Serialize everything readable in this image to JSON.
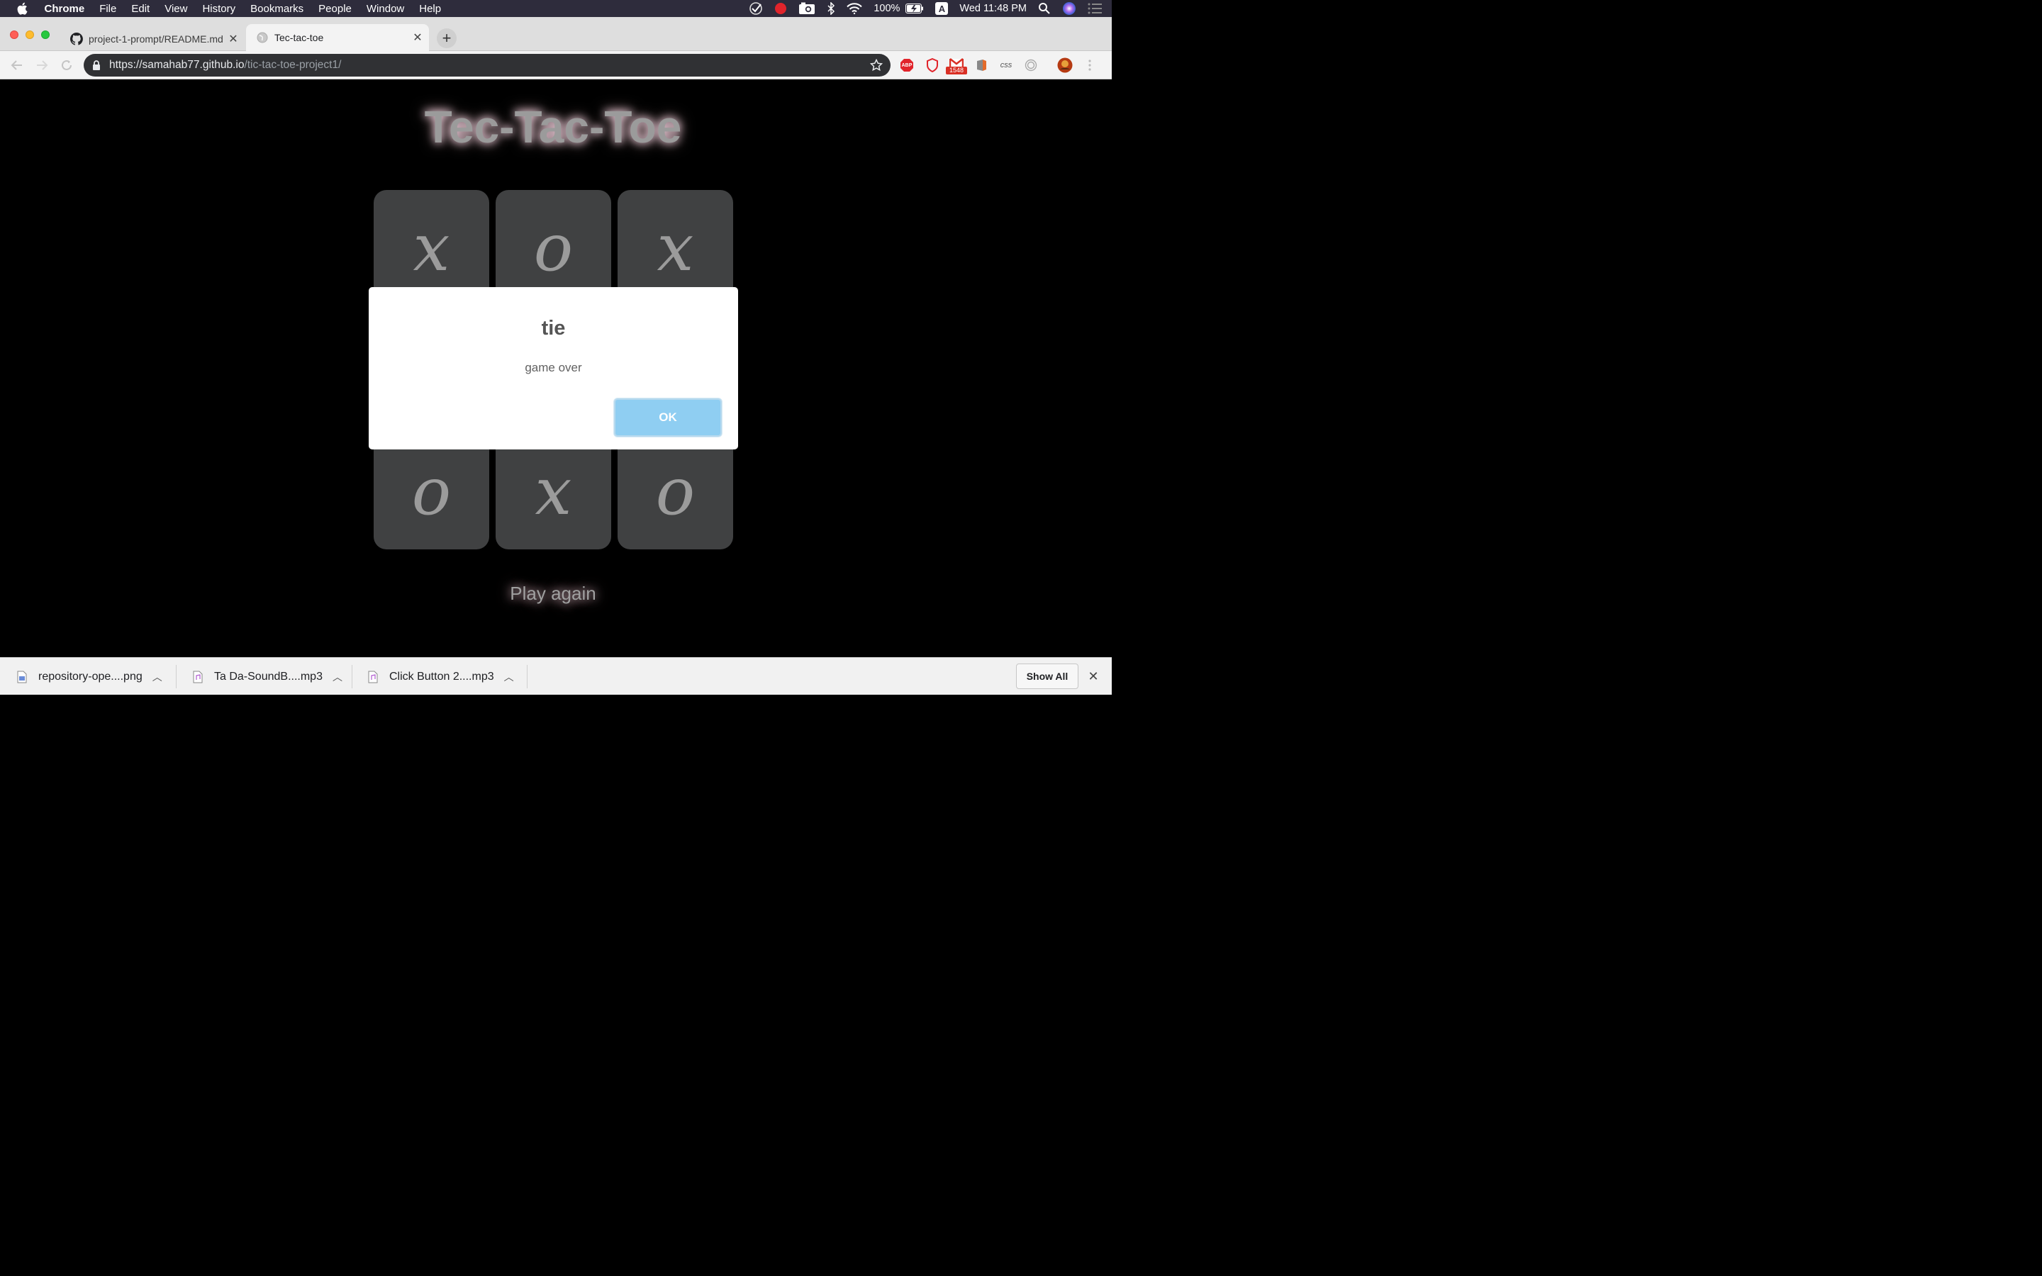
{
  "menubar": {
    "app_name": "Chrome",
    "items": [
      "File",
      "Edit",
      "View",
      "History",
      "Bookmarks",
      "People",
      "Window",
      "Help"
    ],
    "battery": "100%",
    "input_source": "A",
    "clock": "Wed 11:48 PM"
  },
  "tabs": [
    {
      "title": "project-1-prompt/README.md",
      "favicon": "github-icon"
    },
    {
      "title": "Tec-tac-toe",
      "favicon": "globe-icon"
    }
  ],
  "toolbar": {
    "url_host": "https://samahab77.github.io",
    "url_path": "/tic-tac-toe-project1/",
    "ext_mail_badge": "1548",
    "ext_css_label": "css",
    "ext_abp_label": "ABP"
  },
  "game": {
    "title": "Tec-Tac-Toe",
    "board": [
      "x",
      "o",
      "x",
      "",
      "",
      "",
      "o",
      "x",
      "o"
    ],
    "play_again": "Play again"
  },
  "dialog": {
    "title": "tie",
    "text": "game over",
    "ok_label": "OK"
  },
  "downloads": {
    "items": [
      {
        "name": "repository-ope....png"
      },
      {
        "name": "Ta Da-SoundB....mp3"
      },
      {
        "name": "Click Button 2....mp3"
      }
    ],
    "show_all_label": "Show All"
  },
  "colors": {
    "menubar_bg": "#2e2c3c",
    "page_bg": "#000000",
    "cell_bg": "#404142",
    "ok_button": "#8fcef2"
  }
}
